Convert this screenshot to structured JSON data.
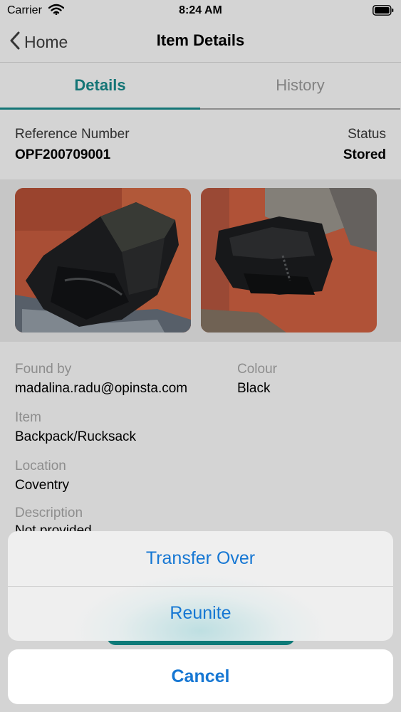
{
  "status_bar": {
    "carrier": "Carrier",
    "time": "8:24 AM"
  },
  "nav": {
    "back_label": "Home",
    "title": "Item Details"
  },
  "tabs": [
    {
      "label": "Details",
      "active": true
    },
    {
      "label": "History",
      "active": false
    }
  ],
  "summary": {
    "reference_label": "Reference Number",
    "reference_value": "OPF200709001",
    "status_label": "Status",
    "status_value": "Stored"
  },
  "fields": {
    "found_by_label": "Found by",
    "found_by_value": "madalina.radu@opinsta.com",
    "colour_label": "Colour",
    "colour_value": "Black",
    "item_label": "Item",
    "item_value": "Backpack/Rucksack",
    "location_label": "Location",
    "location_value": "Coventry",
    "description_label": "Description",
    "description_value": "Not provided"
  },
  "action_sheet": {
    "actions": [
      "Transfer Over",
      "Reunite"
    ],
    "cancel_label": "Cancel"
  },
  "colors": {
    "accent": "#167f80",
    "action_blue": "#1677d3"
  }
}
